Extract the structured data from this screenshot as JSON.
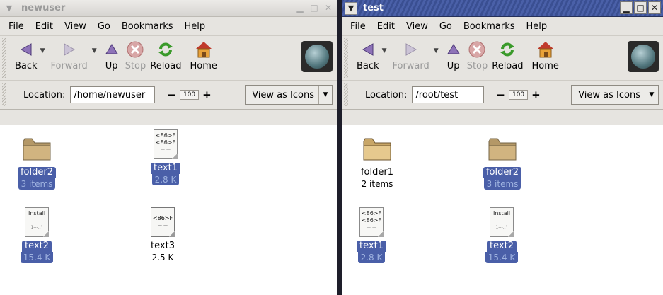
{
  "windows": [
    {
      "title": "newuser",
      "title_active": false,
      "menu_icon": "chevron-down",
      "title_buttons": [
        "▁",
        "□",
        "✕"
      ],
      "menu": [
        {
          "ul": "F",
          "rest": "ile"
        },
        {
          "ul": "E",
          "rest": "dit"
        },
        {
          "ul": "V",
          "rest": "iew"
        },
        {
          "ul": "G",
          "rest": "o"
        },
        {
          "ul": "B",
          "rest": "ookmarks"
        },
        {
          "ul": "H",
          "rest": "elp"
        }
      ],
      "toolbar": {
        "back": "Back",
        "forward": "Forward",
        "up": "Up",
        "stop": "Stop",
        "reload": "Reload",
        "home": "Home"
      },
      "location": {
        "label": "Location:",
        "value": "/home/newuser"
      },
      "zoom": {
        "minus": "−",
        "value": "100",
        "plus": "+"
      },
      "view_as": "View as Icons",
      "items": [
        {
          "name": "folder2",
          "info": "3 items",
          "type": "folder",
          "selected": true
        },
        {
          "name": "text1",
          "info": "2.8 K",
          "type": "text",
          "selected": true,
          "lines": [
            "<86>F",
            "<86>F"
          ]
        },
        {
          "name": "text2",
          "info": "15.4 K",
          "type": "install",
          "selected": true,
          "lines": [
            "Install"
          ]
        },
        {
          "name": "text3",
          "info": "2.5 K",
          "type": "text",
          "selected": false,
          "lines": [
            "<86>F"
          ]
        }
      ]
    },
    {
      "title": "test",
      "title_active": true,
      "menu_icon": "chevron-down",
      "title_buttons": [
        "▁",
        "□",
        "✕"
      ],
      "menu": [
        {
          "ul": "F",
          "rest": "ile"
        },
        {
          "ul": "E",
          "rest": "dit"
        },
        {
          "ul": "V",
          "rest": "iew"
        },
        {
          "ul": "G",
          "rest": "o"
        },
        {
          "ul": "B",
          "rest": "ookmarks"
        },
        {
          "ul": "H",
          "rest": "elp"
        }
      ],
      "toolbar": {
        "back": "Back",
        "forward": "Forward",
        "up": "Up",
        "stop": "Stop",
        "reload": "Reload",
        "home": "Home"
      },
      "location": {
        "label": "Location:",
        "value": "/root/test"
      },
      "zoom": {
        "minus": "−",
        "value": "100",
        "plus": "+"
      },
      "view_as": "View as Icons",
      "items": [
        {
          "name": "folder1",
          "info": "2 items",
          "type": "folder",
          "selected": false
        },
        {
          "name": "folder2",
          "info": "3 items",
          "type": "folder",
          "selected": true
        },
        {
          "name": "text1",
          "info": "2.8 K",
          "type": "text",
          "selected": true,
          "lines": [
            "<86>F",
            "<86>F"
          ]
        },
        {
          "name": "text2",
          "info": "15.4 K",
          "type": "install",
          "selected": true,
          "lines": [
            "Install"
          ]
        }
      ]
    }
  ],
  "colors": {
    "selection": "#4a5fa8",
    "active_title": "#3a4f92"
  }
}
